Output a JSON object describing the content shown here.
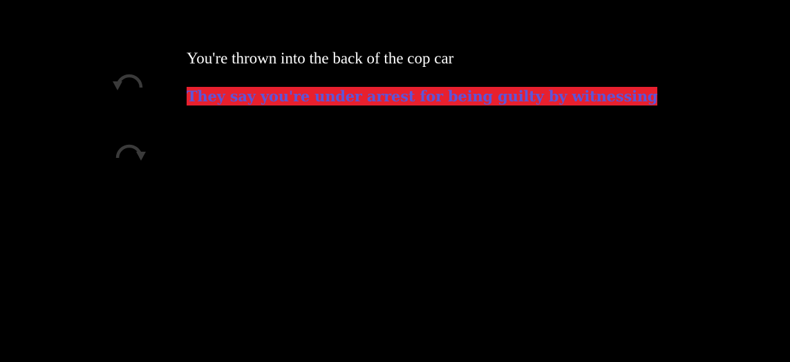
{
  "sidebar": {
    "undo_icon": "undo-arrow-icon",
    "redo_icon": "redo-arrow-icon",
    "icon_color": "#3a3a3a"
  },
  "story": {
    "passage": "You're thrown into the back of the cop car",
    "link": "They say you're under arrest for being guilty by witnessing"
  },
  "colors": {
    "background": "#000000",
    "text": "#ffffff",
    "link_background": "#e8202e",
    "link_text": "#5d55d9"
  }
}
